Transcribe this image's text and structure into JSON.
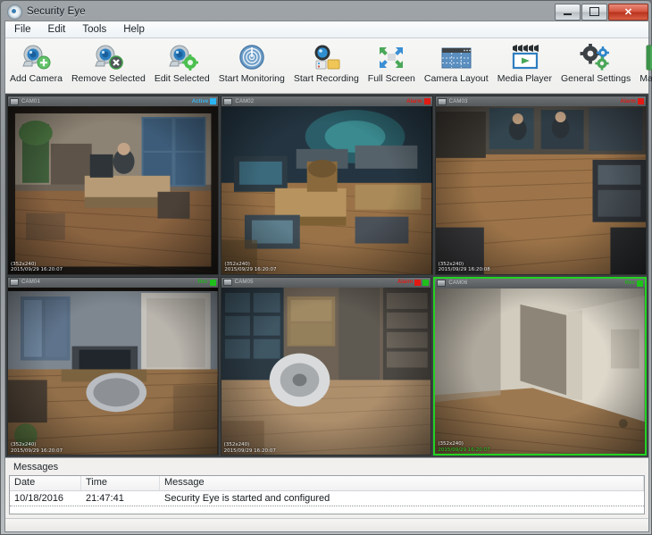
{
  "window": {
    "title": "Security Eye",
    "icon": "app-eye-icon",
    "buttons": {
      "minimize": "–",
      "maximize": "□",
      "close": "✕"
    }
  },
  "menu": {
    "items": [
      {
        "label": "File"
      },
      {
        "label": "Edit"
      },
      {
        "label": "Tools"
      },
      {
        "label": "Help"
      }
    ]
  },
  "toolbar": {
    "items": [
      {
        "label": "Add Camera",
        "icon": "camera-add-icon"
      },
      {
        "label": "Remove Selected",
        "icon": "camera-remove-icon"
      },
      {
        "label": "Edit Selected",
        "icon": "camera-edit-icon"
      },
      {
        "label": "Start Monitoring",
        "icon": "radar-monitor-icon"
      },
      {
        "label": "Start Recording",
        "icon": "record-icon"
      },
      {
        "label": "Full Screen",
        "icon": "fullscreen-arrows-icon"
      },
      {
        "label": "Camera Layout",
        "icon": "grid-layout-icon"
      },
      {
        "label": "Media Player",
        "icon": "film-play-icon"
      },
      {
        "label": "General Settings",
        "icon": "gears-icon"
      },
      {
        "label": "Manual",
        "icon": "book-icon"
      }
    ]
  },
  "cameras": [
    {
      "name": "CAM01",
      "status_label": "Active",
      "status_type": "active",
      "led_color": "#2ab4f2",
      "resolution": "(352x240)",
      "timestamp": "2015/09/29 16:20:07",
      "selected": false,
      "scene": "office-desk-left"
    },
    {
      "name": "CAM02",
      "status_label": "Alarm",
      "status_type": "alarm",
      "led_color": "#e01b14",
      "resolution": "(352x240)",
      "timestamp": "2015/09/29 16:20:07",
      "selected": false,
      "scene": "office-open-plan"
    },
    {
      "name": "CAM03",
      "status_label": "Alarm",
      "status_type": "alarm",
      "led_color": "#e01b14",
      "resolution": "(352x240)",
      "timestamp": "2015/09/29 16:20:08",
      "selected": false,
      "scene": "office-overhead"
    },
    {
      "name": "CAM04",
      "status_label": "Rec",
      "status_type": "rec",
      "led_color": "#1fc01b",
      "resolution": "(352x240)",
      "timestamp": "2015/09/29 16:20:07",
      "selected": false,
      "scene": "office-corner-desk"
    },
    {
      "name": "CAM05",
      "status_label": "Alarm",
      "status_type": "alarm",
      "led_color": "#e01b14",
      "resolution": "(352x240)",
      "timestamp": "2015/09/29 16:20:07",
      "selected": false,
      "scene": "storage-room"
    },
    {
      "name": "CAM06",
      "status_label": "Rec",
      "status_type": "rec",
      "led_color": "#1fc01b",
      "resolution": "(352x240)",
      "timestamp": "2015/09/29 16:20:07",
      "selected": true,
      "scene": "hallway"
    }
  ],
  "messages": {
    "title": "Messages",
    "columns": [
      {
        "key": "date",
        "label": "Date"
      },
      {
        "key": "time",
        "label": "Time"
      },
      {
        "key": "message",
        "label": "Message"
      }
    ],
    "rows": [
      {
        "date": "10/18/2016",
        "time": "21:47:41",
        "message": "Security Eye is started and configured"
      }
    ]
  },
  "colors": {
    "accent_blue": "#2ab4f2",
    "alarm_red": "#e01b14",
    "rec_green": "#1fc01b",
    "selection_green": "#22d321",
    "titlebar_close": "#c0392b"
  }
}
